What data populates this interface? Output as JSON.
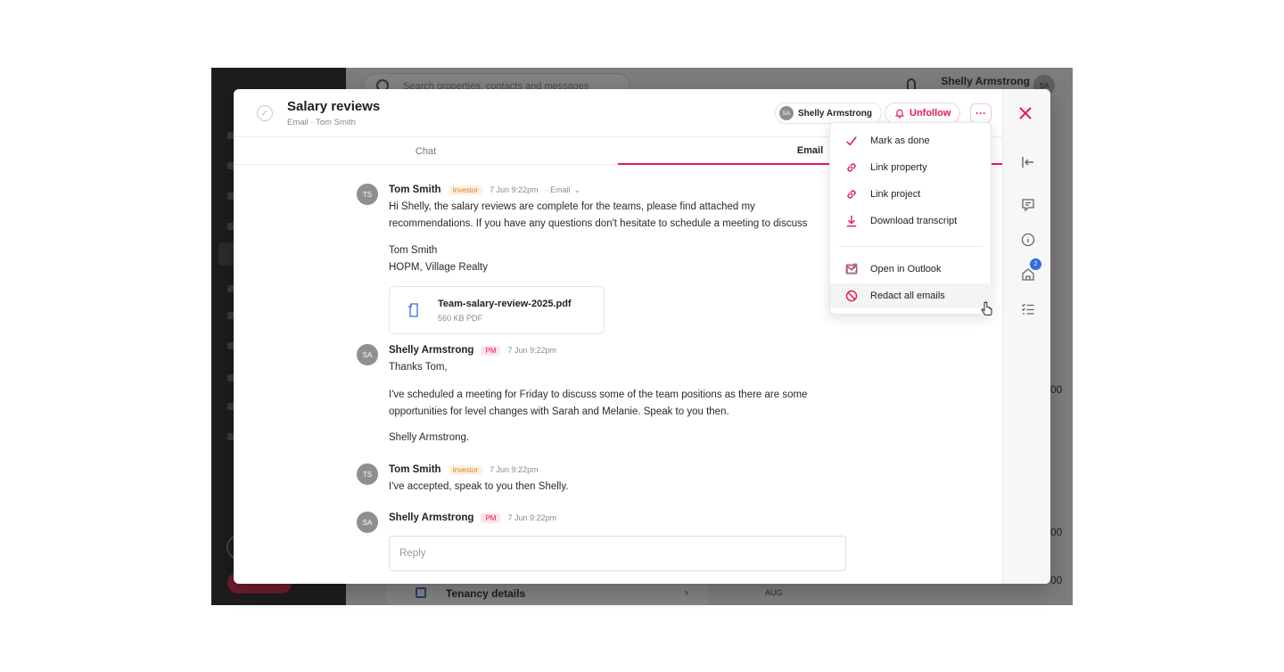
{
  "background_app": {
    "search": {
      "placeholder": "Search properties, contacts and messages"
    },
    "user": {
      "name": "Shelly Armstrong",
      "initials": "SA"
    },
    "edge_values": [
      "00",
      "00",
      "00"
    ],
    "bottom": {
      "tenancy_label": "Tenancy details",
      "month": "AUG"
    }
  },
  "modal": {
    "title": "Salary reviews",
    "subtitle": "Email · Tom Smith",
    "assignee": {
      "initials": "SA",
      "name": "Shelly Armstrong"
    },
    "unfollow_label": "Unfollow",
    "more_label": "···",
    "tabs": [
      {
        "label": "Chat"
      },
      {
        "label": "Email"
      }
    ],
    "active_tab": "Email",
    "rail": {
      "badge_count": "2"
    }
  },
  "messages": [
    {
      "initials": "TS",
      "author": "Tom Smith",
      "role": "Investor",
      "time": "7 Jun 9:22pm",
      "channel": "· Email",
      "lines": [
        "Hi Shelly, the salary reviews are complete for the teams, please find attached my",
        "recommendations. If you have any questions don't hesitate to schedule a meeting to discuss",
        "",
        "Tom Smith",
        "HOPM, Village Realty"
      ],
      "attachment": {
        "name": "Team-salary-review-2025.pdf",
        "size": "560 KB PDF"
      }
    },
    {
      "initials": "SA",
      "author": "Shelly Armstrong",
      "role": "PM",
      "time": "7 Jun 9:22pm",
      "lines": [
        "Thanks Tom,",
        "I've scheduled a meeting for Friday to discuss some of the team positions as there are some",
        "opportunities for level changes with Sarah and Melanie. Speak to you then.",
        "Shelly Armstrong."
      ]
    },
    {
      "initials": "TS",
      "author": "Tom Smith",
      "role": "Investor",
      "time": "7 Jun 9:22pm",
      "lines": [
        "I've accepted, speak to you then Shelly."
      ]
    },
    {
      "initials": "SA",
      "author": "Shelly Armstrong",
      "role": "PM",
      "time": "7 Jun 9:22pm",
      "lines": []
    }
  ],
  "reply": {
    "placeholder": "Reply"
  },
  "menu": {
    "items": [
      {
        "label": "Mark as done",
        "icon": "check-icon"
      },
      {
        "label": "Link property",
        "icon": "link-icon"
      },
      {
        "label": "Link project",
        "icon": "link-icon"
      },
      {
        "label": "Download transcript",
        "icon": "download-icon"
      },
      {
        "label": "Open in Outlook",
        "icon": "mail-icon"
      },
      {
        "label": "Redact all emails",
        "icon": "block-icon"
      }
    ]
  },
  "colors": {
    "accent": "#e5194b",
    "badge_blue": "#2f6fe0",
    "investor": "#d2812c"
  }
}
